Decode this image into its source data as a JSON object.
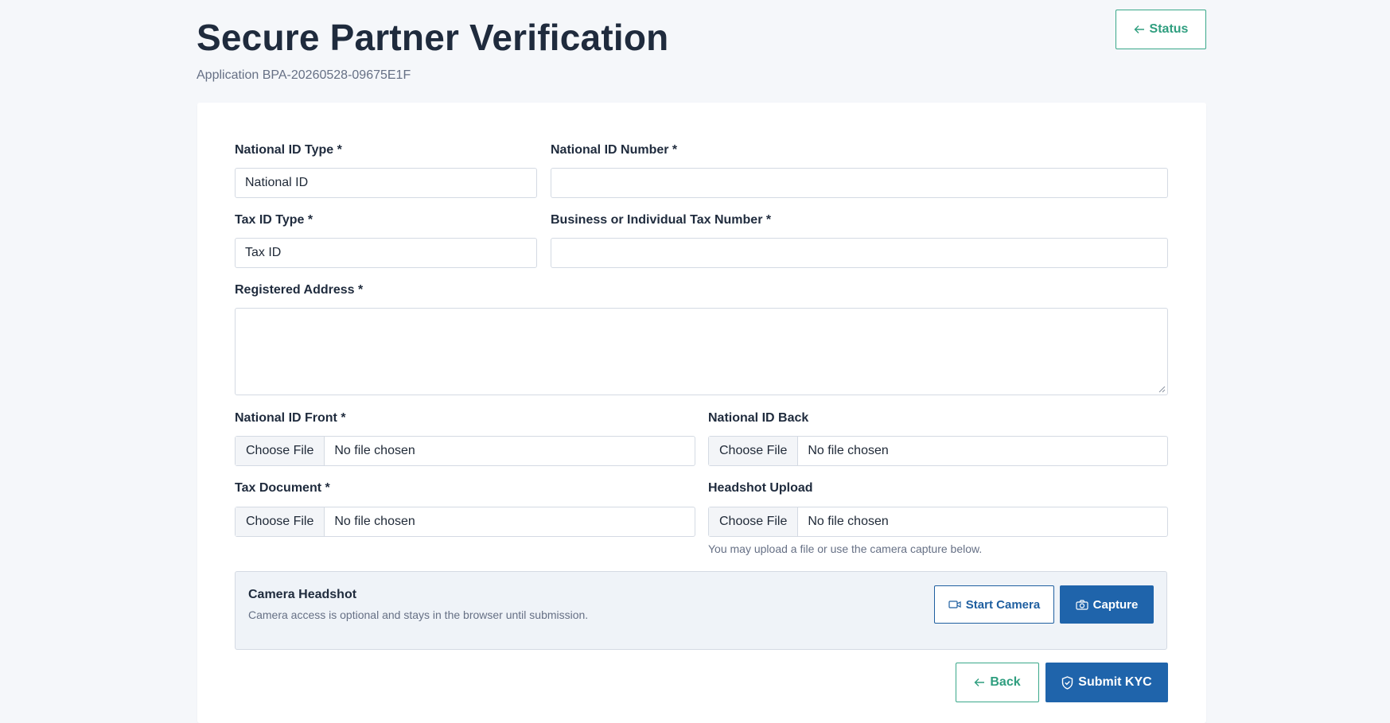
{
  "header": {
    "title": "Secure Partner Verification",
    "subtitle": "Application BPA-20260528-09675E1F",
    "status_label": "Status"
  },
  "form": {
    "national_id_type": {
      "label": "National ID Type *",
      "value": "National ID"
    },
    "national_id_number": {
      "label": "National ID Number *",
      "value": ""
    },
    "tax_id_type": {
      "label": "Tax ID Type *",
      "value": "Tax ID"
    },
    "tax_number": {
      "label": "Business or Individual Tax Number *",
      "value": ""
    },
    "registered_address": {
      "label": "Registered Address *",
      "value": ""
    },
    "national_id_front": {
      "label": "National ID Front *",
      "button": "Choose File",
      "status": "No file chosen"
    },
    "national_id_back": {
      "label": "National ID Back",
      "button": "Choose File",
      "status": "No file chosen"
    },
    "tax_document": {
      "label": "Tax Document *",
      "button": "Choose File",
      "status": "No file chosen"
    },
    "headshot_upload": {
      "label": "Headshot Upload",
      "button": "Choose File",
      "status": "No file chosen",
      "hint": "You may upload a file or use the camera capture below."
    }
  },
  "camera": {
    "title": "Camera Headshot",
    "description": "Camera access is optional and stays in the browser until submission.",
    "start_label": "Start Camera",
    "capture_label": "Capture"
  },
  "actions": {
    "back_label": "Back",
    "submit_label": "Submit KYC"
  },
  "colors": {
    "accent_green": "#2f9e7f",
    "primary_blue": "#1f64ab",
    "background": "#f5f7fa"
  },
  "icons": [
    "arrow-left-icon",
    "video-icon",
    "camera-icon",
    "shield-check-icon"
  ]
}
